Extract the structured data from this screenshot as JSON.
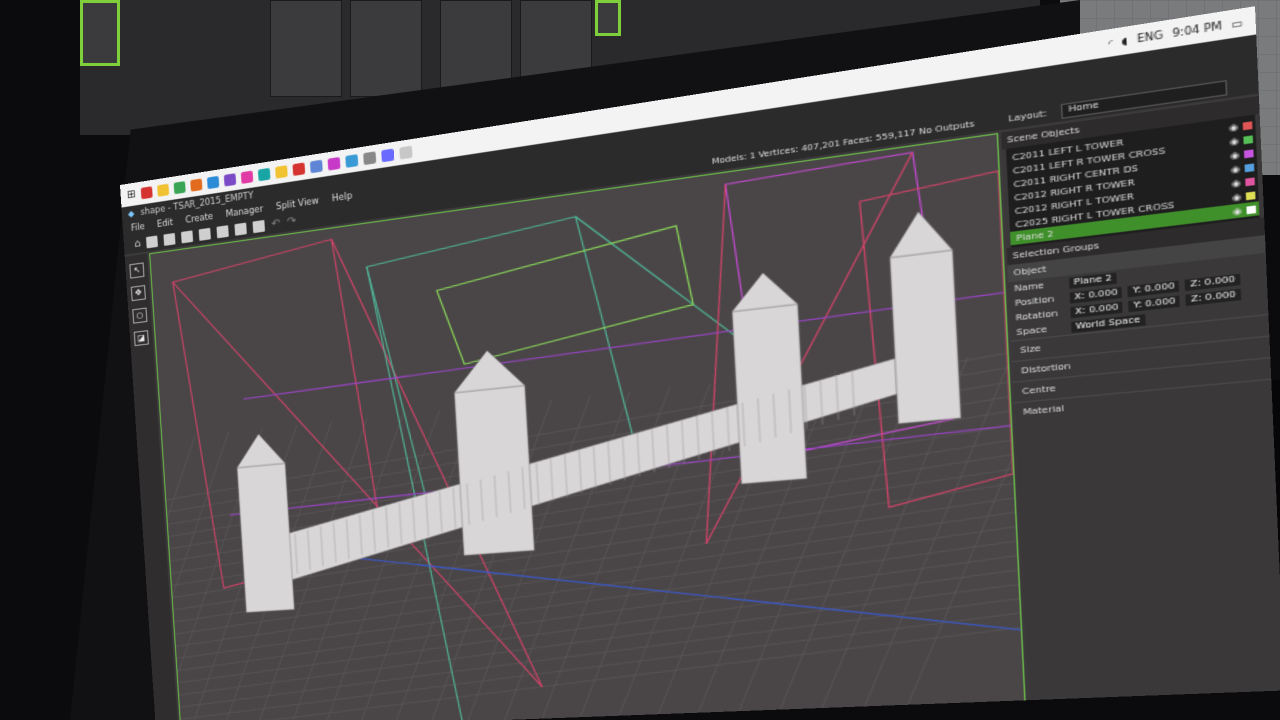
{
  "taskbar": {
    "time": "9:04 PM",
    "lang": "ENG",
    "icons": [
      "#d4332f",
      "#f1c232",
      "#3aa655",
      "#e26b1d",
      "#2c8bd6",
      "#7b4ac7",
      "#e03aa5",
      "#1aa5a5",
      "#f1c232",
      "#d4332f",
      "#5f86d6",
      "#c73ac7",
      "#3a9ad6",
      "#888888",
      "#6a6aff",
      "#c7c7c7"
    ]
  },
  "window": {
    "title": "shape - TSAR_2015_EMPTY",
    "menu": [
      "File",
      "Edit",
      "Create",
      "Manager",
      "Split View",
      "Help"
    ]
  },
  "stats": {
    "text": "Models: 1   Vertices: 407,201   Faces: 559,117   No Outputs"
  },
  "layout": {
    "label": "Layout:",
    "value": "Home"
  },
  "sidebar_tools": [
    "↖",
    "✥",
    "○",
    "◪"
  ],
  "scene_objects": {
    "header": "Scene Objects",
    "items": [
      {
        "label": "C2011 LEFT L TOWER",
        "color": "#e05555"
      },
      {
        "label": "C2011 LEFT R TOWER CROSS",
        "color": "#55c055"
      },
      {
        "label": "C2011 RIGHT CENTR DS",
        "color": "#c855e0"
      },
      {
        "label": "C2012 RIGHT R TOWER",
        "color": "#55a0e0"
      },
      {
        "label": "C2012 RIGHT L TOWER",
        "color": "#e055a0"
      },
      {
        "label": "C2025 RIGHT L TOWER CROSS",
        "color": "#e0e055"
      },
      {
        "label": "Plane 2",
        "color": "#ffffff"
      }
    ]
  },
  "properties": {
    "selection_groups": "Selection Groups",
    "object_tab": "Object",
    "name_label": "Name",
    "name_value": "Plane 2",
    "position_label": "Position",
    "rotation_label": "Rotation",
    "space_label": "Space",
    "space_value": "World Space",
    "x": "X: 0.000",
    "y": "Y: 0.000",
    "z": "Z: 0.000",
    "sections": [
      "Size",
      "Distortion",
      "Centre",
      "Material"
    ]
  }
}
